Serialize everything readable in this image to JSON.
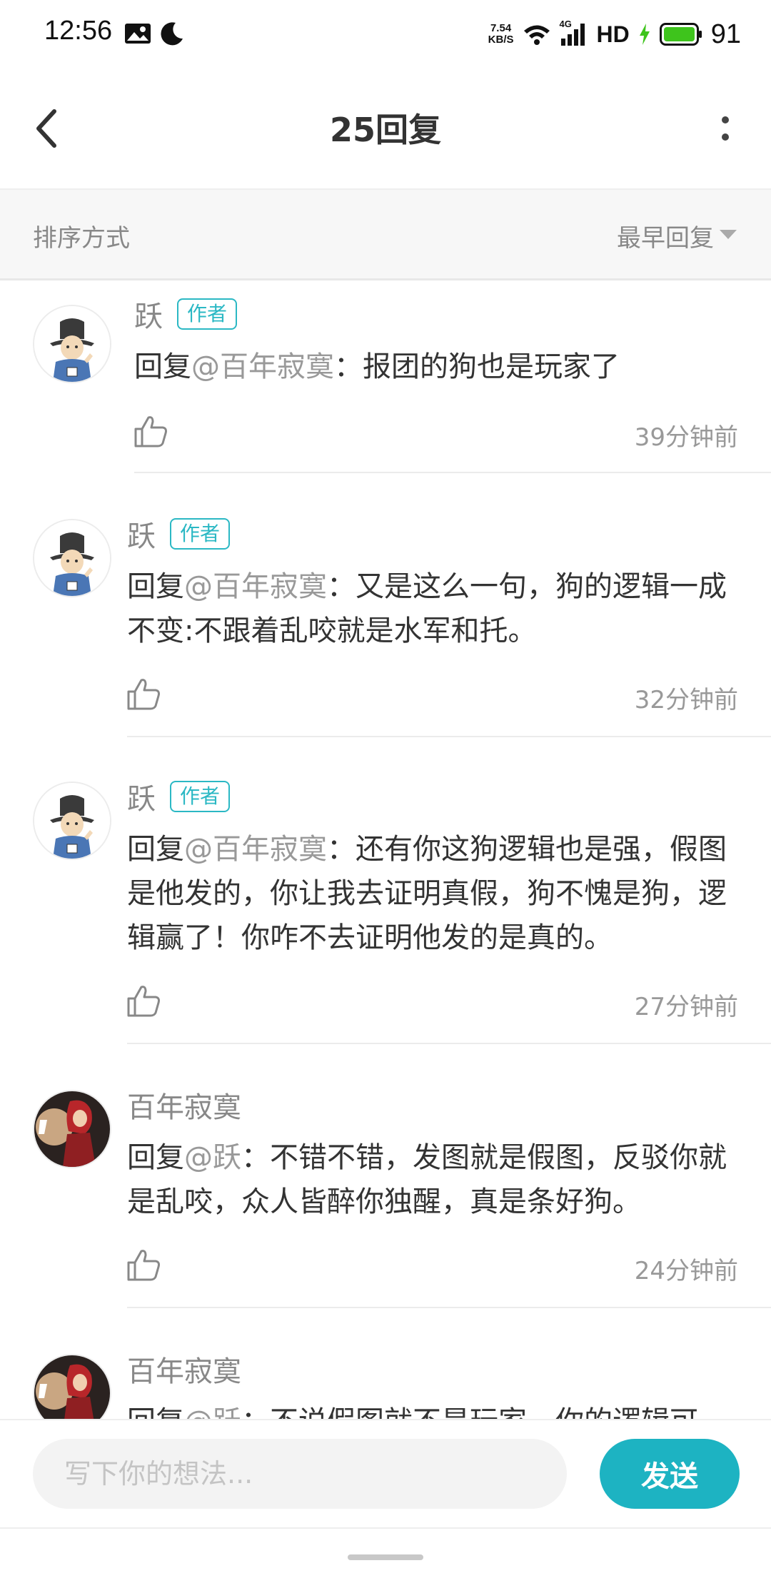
{
  "status_bar": {
    "time": "12:56",
    "net_speed_value": "7.54",
    "net_speed_unit": "KB/S",
    "signal_label": "4G",
    "hd_label": "HD",
    "battery": "91",
    "icons": [
      "gallery-icon",
      "moon-icon",
      "wifi-icon",
      "signal-icon",
      "charging-icon",
      "battery-icon"
    ]
  },
  "header": {
    "title": "25回复"
  },
  "sort": {
    "label": "排序方式",
    "value": "最早回复"
  },
  "comments": [
    {
      "username": "跃",
      "badge": "作者",
      "reply_prefix": "回复",
      "mention": "@百年寂寞",
      "text": "：报团的狗也是玩家了",
      "time": "39分钟前",
      "avatar": "official-avatar"
    },
    {
      "username": "跃",
      "badge": "作者",
      "reply_prefix": "回复",
      "mention": "@百年寂寞",
      "text": "：又是这么一句，狗的逻辑一成不变:不跟着乱咬就是水军和托。",
      "time": "32分钟前",
      "avatar": "official-avatar"
    },
    {
      "username": "跃",
      "badge": "作者",
      "reply_prefix": "回复",
      "mention": "@百年寂寞",
      "text": "：还有你这狗逻辑也是强，假图是他发的，你让我去证明真假，狗不愧是狗，逻辑赢了！你咋不去证明他发的是真的。",
      "time": "27分钟前",
      "avatar": "official-avatar"
    },
    {
      "username": "百年寂寞",
      "badge": "",
      "reply_prefix": "回复",
      "mention": "@跃",
      "text": "：不错不错，发图就是假图，反驳你就是乱咬，众人皆醉你独醒，真是条好狗。",
      "time": "24分钟前",
      "avatar": "girl-avatar"
    },
    {
      "username": "百年寂寞",
      "badge": "",
      "reply_prefix": "回复",
      "mention": "@跃",
      "text": "：不说假图就不是玩家，你的逻辑可",
      "time": "",
      "avatar": "girl-avatar"
    }
  ],
  "input": {
    "placeholder": "写下你的想法...",
    "value": "",
    "send_label": "发送"
  },
  "colors": {
    "accent": "#1db3c2",
    "badge": "#2bb8c4",
    "battery": "#3ec41c"
  }
}
